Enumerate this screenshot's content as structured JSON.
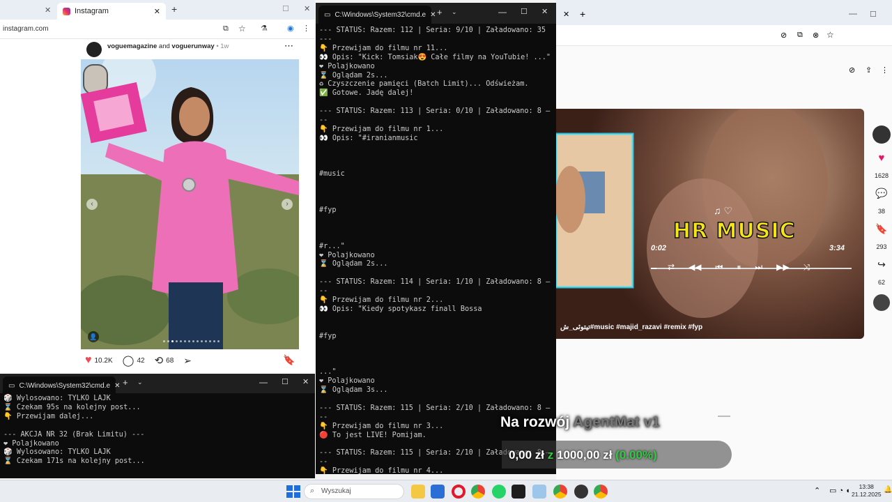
{
  "instagram": {
    "tab_title": "Instagram",
    "url": "instagram.com",
    "author": "voguemagazine",
    "and_text": "and",
    "coauthor": "voguerunway",
    "time": "• 1w",
    "likes": "10.2K",
    "comments": "42",
    "reposts": "68"
  },
  "cmd_main": {
    "title": "C:\\Windows\\System32\\cmd.e",
    "lines": [
      "--- STATUS: Razem: 112 | Seria: 9/10 | Załadowano: 35",
      "---",
      "👇 Przewijam do filmu nr 11...",
      "👀 Opis: \"Kick: Tomsiak😍 Całe filmy na YouTubie! ...\"",
      "❤ Polajkowano",
      "⌛ Oglądam 2s...",
      "♻ Czyszczenie pamięci (Batch Limit)... Odświeżam.",
      "✅ Gotowe. Jadę dalej!",
      "",
      "--- STATUS: Razem: 113 | Seria: 0/10 | Załadowano: 8 –",
      "--",
      "👇 Przewijam do filmu nr 1...",
      "👀 Opis: \"#iranianmusic",
      "",
      "",
      "",
      "#music",
      "",
      "",
      "",
      "#fyp",
      "",
      "",
      "",
      "#r...\"",
      "❤ Polajkowano",
      "⌛ Oglądam 2s...",
      "",
      "--- STATUS: Razem: 114 | Seria: 1/10 | Załadowano: 8 –",
      "--",
      "👇 Przewijam do filmu nr 2...",
      "👀 Opis: \"Kiedy spotykasz finall Bossa",
      "",
      "",
      "#fyp",
      "",
      "",
      "",
      "...\"",
      "❤ Polajkowano",
      "⌛ Oglądam 3s...",
      "",
      "--- STATUS: Razem: 115 | Seria: 2/10 | Załadowano: 8 –",
      "--",
      "👇 Przewijam do filmu nr 3...",
      "🔴 To jest LIVE! Pomijam.",
      "",
      "--- STATUS: Razem: 115 | Seria: 2/10 | Załadowano: 8 –",
      "--",
      "👇 Przewijam do filmu nr 4..."
    ]
  },
  "cmd_small": {
    "title": "C:\\Windows\\System32\\cmd.e",
    "lines": [
      "🎲 Wylosowano: TYLKO LAJK",
      "⌛ Czekam 95s na kolejny post...",
      "👇 Przewijam dalej...",
      "",
      "--- AKCJA NR 32 (Brak Limitu) ---",
      "❤ Polajkowano",
      "🎲 Wylosowano: TYLKO LAJK",
      "⌛ Czekam 171s na kolejny post..."
    ]
  },
  "video": {
    "title": "HR MUSIC",
    "time_current": "0:02",
    "time_total": "3:34",
    "caption": "تیتوئی_ش#music #majid_razavi #remix #fyp"
  },
  "side_rail": {
    "likes": "1628",
    "comments": "38",
    "saves": "293",
    "shares": "62"
  },
  "overlay": {
    "heading_white": "Na rozwój ",
    "heading_dim": "AgentMat v1",
    "amount": "0,00 zł",
    "z_text": "z",
    "goal": "1000,00 zł",
    "percent": "(0.00%)"
  },
  "taskbar": {
    "search_placeholder": "Wyszukaj",
    "time": "13:38",
    "date": "21.12.2025"
  },
  "colors": {
    "heart": "#ed4956",
    "accent_green": "#2ecc40",
    "title_yellow": "#f6e41a"
  }
}
